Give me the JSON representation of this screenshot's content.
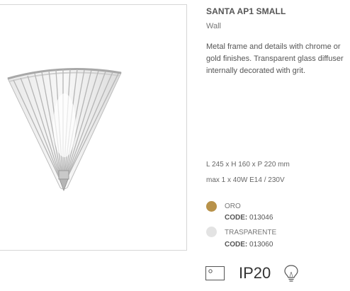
{
  "product": {
    "name": "SANTA AP1 SMALL",
    "category": "Wall",
    "description": "Metal frame and details with chrome or gold finishes. Transparent glass diffuser internally decorated with grit.",
    "dimensions": "L 245 x H 160 x P 220 mm",
    "bulb": "max 1 x 40W E14 / 230V"
  },
  "finishes": [
    {
      "name": "ORO",
      "code_label": "CODE:",
      "code": "013046",
      "color": "#b8924a"
    },
    {
      "name": "TRASPARENTE",
      "code_label": "CODE:",
      "code": "013060",
      "color": "#e3e3e3"
    }
  ],
  "rating": {
    "ip": "IP20",
    "icons": [
      "class-ii-insulation-icon",
      "lightbulb-icon"
    ]
  },
  "image": {
    "subject": "lamp-photo"
  }
}
